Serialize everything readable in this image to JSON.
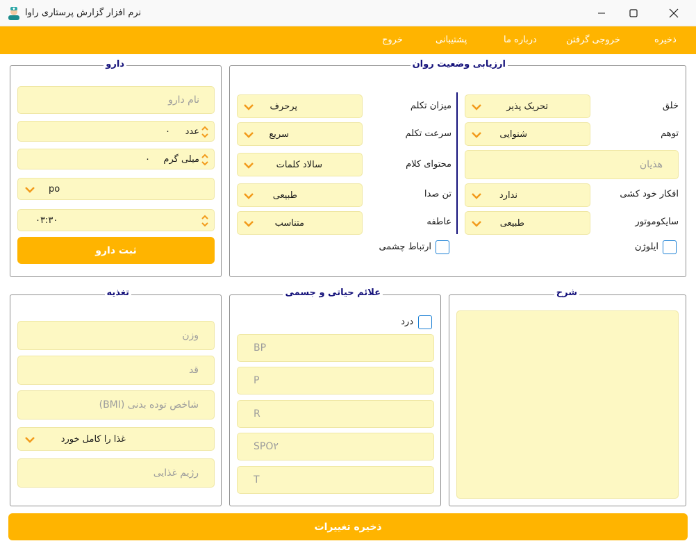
{
  "window": {
    "title": "نرم افزار گزارش پرستاری راوا"
  },
  "menu": {
    "save": "ذخیره",
    "export": "خروجی گرفتن",
    "about": "درباره ما",
    "support": "پشتیبانی",
    "exit": "خروج"
  },
  "drug": {
    "title": "دارو",
    "name_placeholder": "نام دارو",
    "count_value": "۰",
    "count_unit": "عدد",
    "dose_value": "۰",
    "dose_unit": "میلی گرم",
    "route": "po",
    "time": "۰۳:۳۰",
    "submit": "ثبت دارو"
  },
  "psych": {
    "title": "ارزیابی وضعیت روان",
    "mood_label": "خلق",
    "mood_value": "تحریک پذیر",
    "halluc_label": "توهم",
    "halluc_value": "شنوایی",
    "delusion_placeholder": "هذیان",
    "suicide_label": "افکار خود کشی",
    "suicide_value": "ندارد",
    "psychomotor_label": "سایکوموتور",
    "psychomotor_value": "طبیعی",
    "elation_label": "ایلوژن",
    "speech_amount_label": "میزان تکلم",
    "speech_amount_value": "پرحرف",
    "speech_rate_label": "سرعت تکلم",
    "speech_rate_value": "سریع",
    "speech_content_label": "محتوای کلام",
    "speech_content_value": "سالاد کلمات",
    "tone_label": "تن صدا",
    "tone_value": "طبیعی",
    "affect_label": "عاطفه",
    "affect_value": "متناسب",
    "eye_contact_label": "ارتباط چشمی"
  },
  "nutrition": {
    "title": "تغذیه",
    "weight_placeholder": "وزن",
    "height_placeholder": "قد",
    "bmi_placeholder": "شاخص توده بدنی (BMI)",
    "food_value": "غذا را کامل خورد",
    "diet_placeholder": "رژیم غذایی"
  },
  "vitals": {
    "title": "علائم حیاتی و جسمی",
    "pain_label": "درد",
    "bp_placeholder": "BP",
    "p_placeholder": "P",
    "r_placeholder": "R",
    "spo2_placeholder": "SPO۲",
    "t_placeholder": "T"
  },
  "description": {
    "title": "شرح"
  },
  "footer": {
    "save_changes": "ذخیره تغییرات"
  },
  "colors": {
    "accent": "#ffb400",
    "field_bg": "#fdf8c3",
    "group_title": "#14117a",
    "checkbox_border": "#1a7fd4"
  }
}
